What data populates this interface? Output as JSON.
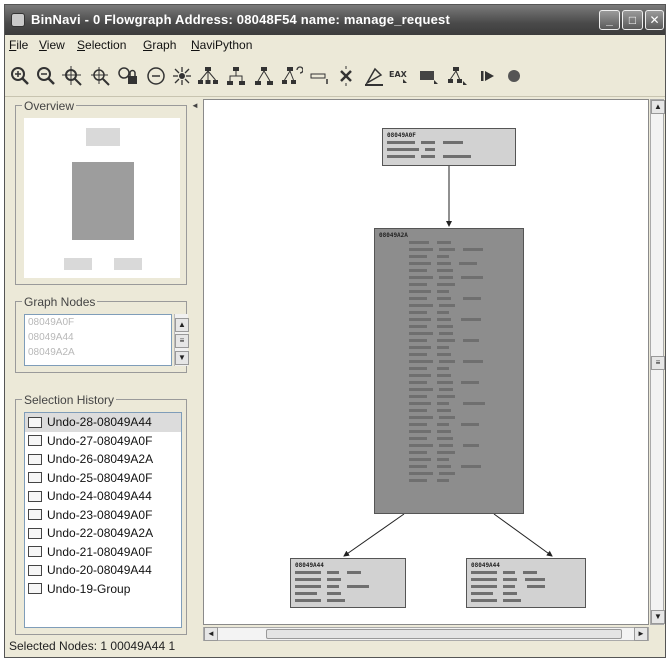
{
  "window": {
    "title": "BinNavi - 0 Flowgraph  Address: 08048F54 name: manage_request",
    "controls": {
      "minimize": "_",
      "maximize": "□",
      "close": "✕"
    }
  },
  "menu": [
    {
      "label": "File",
      "key": "F",
      "rest": "ile"
    },
    {
      "label": "View",
      "key": "V",
      "rest": "iew"
    },
    {
      "label": "Selection",
      "key": "S",
      "rest": "election"
    },
    {
      "label": "Graph",
      "key": "G",
      "rest": "raph"
    },
    {
      "label": "NaviPython",
      "key": "N",
      "rest": "aviPython"
    }
  ],
  "toolbar": {
    "icons": [
      "zoom-in-icon",
      "zoom-out-icon",
      "zoom-fit-icon",
      "zoom-selection-icon",
      "lock-zoom-icon",
      "center-icon",
      "circular-layout-icon",
      "hierarchic-layout-icon",
      "orthogonal-layout-icon",
      "tree-layout-icon",
      "layout-options-icon",
      "collapse-icon",
      "delete-icon",
      "highlight-icon",
      "eax-register-icon",
      "memory-icon",
      "graph-tools-icon",
      "run-icon",
      "record-icon"
    ]
  },
  "overview": {
    "title": "Overview"
  },
  "graph_nodes": {
    "title": "Graph Nodes",
    "items": [
      "08049A0F",
      "08049A44",
      "08049A2A"
    ]
  },
  "selection_history": {
    "title": "Selection History",
    "items": [
      "Undo-28-08049A44",
      "Undo-27-08049A0F",
      "Undo-26-08049A2A",
      "Undo-25-08049A0F",
      "Undo-24-08049A44",
      "Undo-23-08049A0F",
      "Undo-22-08049A2A",
      "Undo-21-08049A0F",
      "Undo-20-08049A44",
      "Undo-19-Group"
    ],
    "selected_index": 0
  },
  "status": {
    "text": "Selected Nodes: 1 00049A44 1"
  },
  "graph": {
    "nodes": [
      {
        "title": "08049A0F",
        "color": "#d2d2d2"
      },
      {
        "title": "08049A2A",
        "color": "#8d8d8d"
      },
      {
        "title": "08049A44",
        "color": "#d2d2d2"
      },
      {
        "title": "08049A44",
        "color": "#d2d2d2"
      }
    ]
  }
}
